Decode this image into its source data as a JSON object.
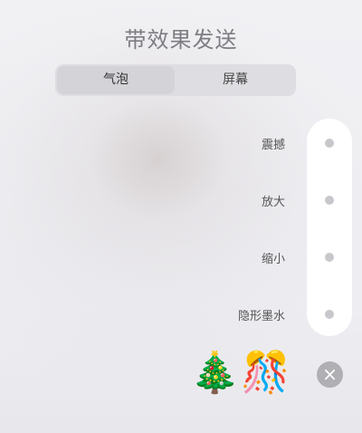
{
  "header": {
    "title": "带效果发送"
  },
  "tabs": [
    {
      "label": "气泡",
      "selected": true
    },
    {
      "label": "屏幕",
      "selected": false
    }
  ],
  "effects": [
    {
      "label": "震撼"
    },
    {
      "label": "放大"
    },
    {
      "label": "缩小"
    },
    {
      "label": "隐形墨水"
    }
  ],
  "emoji_bar": {
    "items": [
      "🎄",
      "🎊"
    ],
    "close_icon": "×"
  },
  "colors": {
    "panel_bg": "#ffffff",
    "selected_tab": "#d3d3d8",
    "dot": "#c8c8cc",
    "close_bg": "#b0b0b4"
  }
}
